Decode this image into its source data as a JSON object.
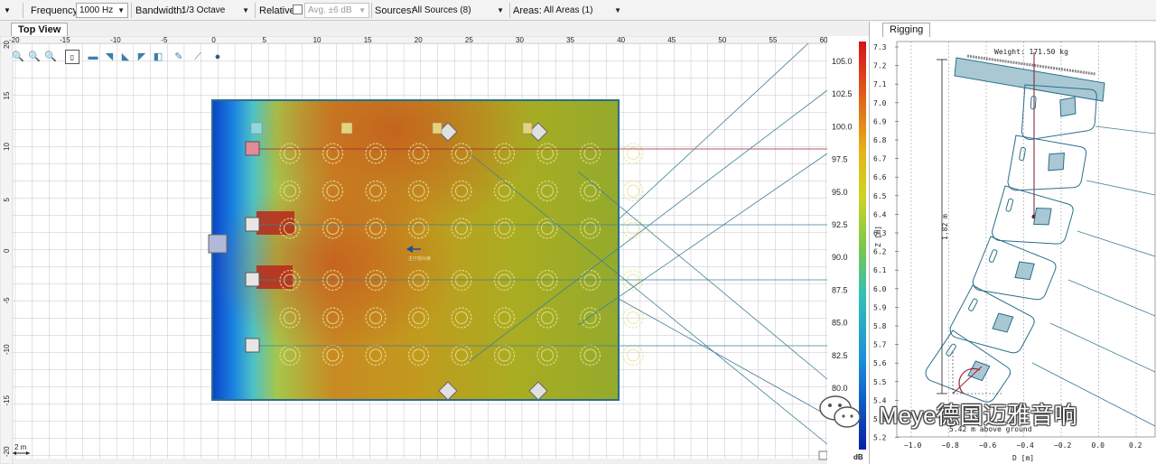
{
  "toolbar": {
    "frequency_label": "Frequency:",
    "frequency_value": "1000 Hz",
    "bandwidth_label": "Bandwidth:",
    "bandwidth_value": "1/3 Octave",
    "relative_label": "Relative:",
    "relative_value": "Avg. ±6 dB",
    "sources_label": "Sources:",
    "sources_value": "All Sources (8)",
    "areas_label": "Areas:",
    "areas_value": "All Areas (1)"
  },
  "top_view": {
    "tab_label": "Top View",
    "ruler_x_labels": [
      "-20",
      "-15",
      "-10",
      "-5",
      "0",
      "5",
      "10",
      "15",
      "20",
      "25",
      "30",
      "35",
      "40",
      "45",
      "50",
      "55",
      "60"
    ],
    "ruler_y_labels": [
      "20",
      "15",
      "10",
      "5",
      "0",
      "-5",
      "-10",
      "-15",
      "-20"
    ],
    "scale_label": "2 m",
    "area_label": "主厅观众席",
    "tools": [
      "zoom-in-icon",
      "zoom-out-icon",
      "zoom-fit-icon",
      "page-icon",
      "box-icon",
      "wedge-icon",
      "wedge-icon",
      "wedge-icon",
      "panel-icon",
      "pencil-icon",
      "measure-icon",
      "speaker-icon"
    ]
  },
  "colorbar": {
    "unit": "dB",
    "labels": [
      "105.0",
      "102.5",
      "100.0",
      "97.5",
      "95.0",
      "92.5",
      "90.0",
      "87.5",
      "85.0",
      "82.5",
      "80.0"
    ]
  },
  "rigging": {
    "tab_label": "Rigging",
    "weight_label": "Weight: 171.50 kg",
    "height_label": "1.82 m",
    "ground_label": "5.42 m above ground",
    "y_axis_label": "Z [m]",
    "x_axis_label": "D [m]",
    "y_ticks": [
      "7.3",
      "7.2",
      "7.1",
      "7.0",
      "6.9",
      "6.8",
      "6.7",
      "6.6",
      "6.5",
      "6.4",
      "6.3",
      "6.2",
      "6.1",
      "6.0",
      "5.9",
      "5.8",
      "5.7",
      "5.6",
      "5.5",
      "5.4",
      "5.3",
      "5.2"
    ],
    "x_ticks": [
      "−1.0",
      "−0.8",
      "−0.6",
      "−0.4",
      "−0.2",
      "0.0",
      "0.2"
    ]
  },
  "watermark": {
    "text": "Meye德国迈雅音响"
  },
  "colors": {
    "panel_border": "#2a6f8a",
    "array_line": "#3f7f96",
    "accent_red": "#a32035"
  }
}
